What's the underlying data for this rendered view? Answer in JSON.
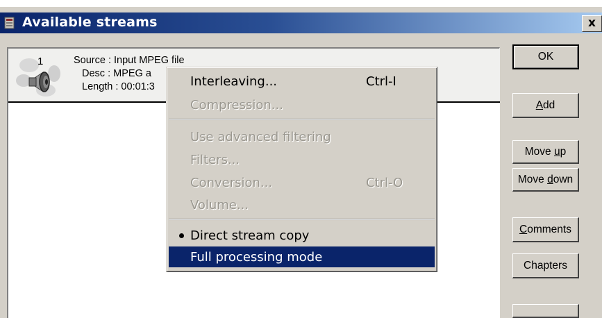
{
  "window": {
    "title": "Available streams",
    "close_label": "x"
  },
  "stream": {
    "number": "1",
    "source": "Source : Input MPEG file",
    "desc": "Desc : MPEG a",
    "length": "Length : 00:01:3"
  },
  "buttons": {
    "ok": "OK",
    "add_pre": "",
    "add_key": "A",
    "add_post": "dd",
    "moveup_pre": "Move ",
    "moveup_key": "u",
    "moveup_post": "p",
    "movedown_pre": "Move ",
    "movedown_key": "d",
    "movedown_post": "own",
    "comments_pre": "",
    "comments_key": "C",
    "comments_post": "omments",
    "chapters": "Chapters"
  },
  "context_menu": {
    "interleaving": "Interleaving...",
    "interleaving_shortcut": "Ctrl-I",
    "compression": "Compression...",
    "advanced_filtering": "Use advanced filtering",
    "filters": "Filters...",
    "conversion": "Conversion...",
    "conversion_shortcut": "Ctrl-O",
    "volume": "Volume...",
    "direct_copy": "Direct stream copy",
    "full_processing": "Full processing mode"
  }
}
